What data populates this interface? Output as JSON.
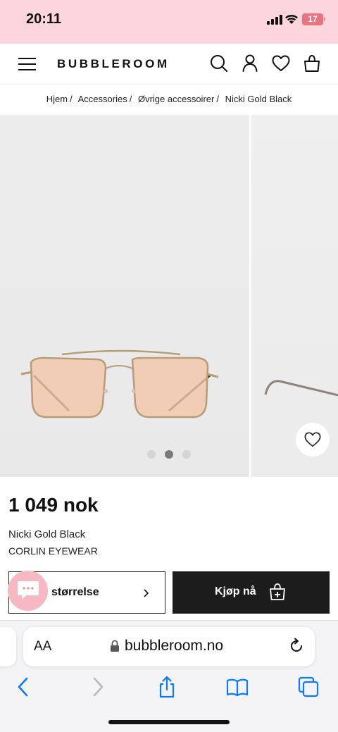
{
  "status_bar": {
    "time": "20:11",
    "battery": "17"
  },
  "header": {
    "logo": "BUBBLEROOM",
    "icons": [
      "menu-icon",
      "search-icon",
      "account-icon",
      "heart-icon",
      "bag-icon"
    ]
  },
  "breadcrumb": {
    "items": [
      "Hjem",
      "Accessories",
      "Øvrige accessoirer",
      "Nicki Gold Black"
    ],
    "separator": "/"
  },
  "gallery": {
    "slide_count": 3,
    "active_slide": 2
  },
  "product": {
    "price": "1 049 nok",
    "name": "Nicki Gold Black",
    "brand": "CORLIN EYEWEAR"
  },
  "actions": {
    "size_label": "størrelse",
    "buy_label": "Kjøp nå"
  },
  "browser": {
    "aa_label": "AA",
    "url": "bubbleroom.no",
    "toolbar_icons": [
      "back-icon",
      "forward-icon",
      "share-icon",
      "bookmarks-icon",
      "tabs-icon"
    ]
  },
  "colors": {
    "status_bg": "#fcd6dc",
    "buy_button": "#1c1c1c",
    "chat_bubble": "#f6b9c3",
    "browser_blue": "#0a7aff"
  }
}
